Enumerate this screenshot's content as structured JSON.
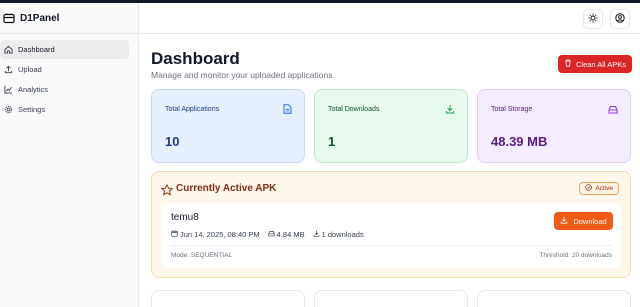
{
  "app": {
    "name": "D1Panel"
  },
  "sidebar": {
    "items": [
      {
        "label": "Dashboard",
        "icon": "home-icon",
        "active": true
      },
      {
        "label": "Upload",
        "icon": "upload-icon",
        "active": false
      },
      {
        "label": "Analytics",
        "icon": "chart-icon",
        "active": false
      },
      {
        "label": "Settings",
        "icon": "gear-icon",
        "active": false
      }
    ]
  },
  "header": {
    "theme_icon": "sun-icon",
    "profile_icon": "user-circle-icon"
  },
  "page": {
    "title": "Dashboard",
    "subtitle": "Manage and monitor your uploaded applications",
    "clean_button": "Clean All APKs"
  },
  "stats": [
    {
      "label": "Total Applications",
      "value": "10",
      "icon": "file-icon",
      "color": "#2563eb"
    },
    {
      "label": "Total Downloads",
      "value": "1",
      "icon": "download-icon",
      "color": "#16a34a"
    },
    {
      "label": "Total Storage",
      "value": "48.39 MB",
      "icon": "drive-icon",
      "color": "#9333ea"
    }
  ],
  "active_apk": {
    "heading": "Currently Active APK",
    "badge": "Active",
    "name": "temu8",
    "date": "Jun 14, 2025, 08:40 PM",
    "size": "4.84 MB",
    "downloads": "1 downloads",
    "download_button": "Download",
    "mode": "Mode: SEQUENTIAL",
    "threshold": "Threshold: 20 downloads"
  },
  "colors": {
    "accent_red": "#dc2626",
    "accent_orange": "#f05a14"
  }
}
